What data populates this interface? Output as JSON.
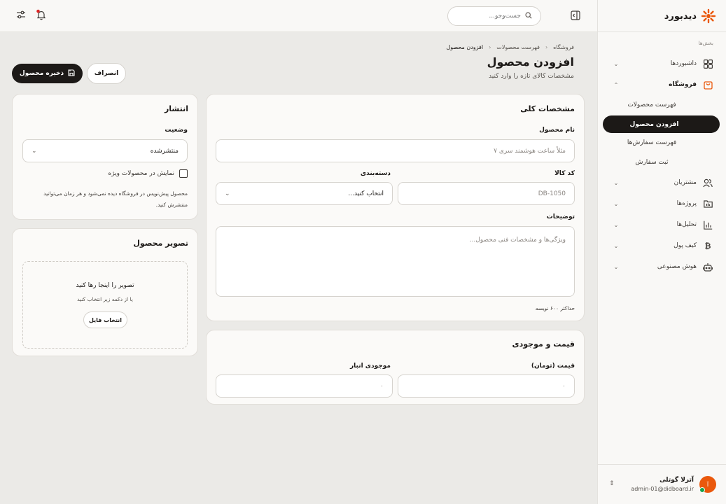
{
  "brand": {
    "name": "دیدبورد",
    "accent": "#ea580c"
  },
  "topbar": {
    "search_placeholder": "جست‌وجو..."
  },
  "sidebar": {
    "section_label": "بخش‌ها",
    "items": [
      {
        "label": "داشبوردها",
        "icon": "grid-icon"
      },
      {
        "label": "فروشگاه",
        "icon": "shopping-bag-icon"
      },
      {
        "label": "مشتریان",
        "icon": "users-icon"
      },
      {
        "label": "پروژه‌ها",
        "icon": "folder-icon"
      },
      {
        "label": "تحلیل‌ها",
        "icon": "bar-chart-icon"
      },
      {
        "label": "کیف پول",
        "icon": "bitcoin-icon"
      },
      {
        "label": "هوش مصنوعی",
        "icon": "robot-icon"
      }
    ],
    "shop_sub": [
      {
        "label": "فهرست محصولات"
      },
      {
        "label": "افزودن محصول",
        "active": true
      },
      {
        "label": "فهرست سفارش‌ها"
      },
      {
        "label": "ثبت سفارش"
      }
    ]
  },
  "user": {
    "name": "آتزلا گوتلی",
    "email": "admin-01@didboard.ir",
    "initial": "آ"
  },
  "breadcrumb": {
    "items": [
      "فروشگاه",
      "فهرست محصولات",
      "افزودن محصول"
    ]
  },
  "page": {
    "title": "افزودن محصول",
    "subtitle": "مشخصات کالای تازه را وارد کنید"
  },
  "actions": {
    "save": "ذخیره محصول",
    "cancel": "انصراف"
  },
  "general": {
    "title": "مشخصات کلی",
    "name_label": "نام محصول",
    "name_placeholder": "مثلاً ساعت هوشمند سری ۷",
    "sku_label": "کد کالا",
    "sku_placeholder": "DB-1050",
    "category_label": "دسته‌بندی",
    "category_value": "انتخاب کنید...",
    "desc_label": "توضیحات",
    "desc_placeholder": "ویژگی‌ها و مشخصات فنی محصول...",
    "desc_hint": "حداکثر ۶۰۰ نویسه"
  },
  "pricing": {
    "title": "قیمت و موجودی",
    "price_label": "قیمت (تومان)",
    "price_value": "۰",
    "stock_label": "موجودی انبار",
    "stock_value": "۰"
  },
  "publish": {
    "title": "انتشار",
    "status_label": "وضعیت",
    "status_value": "منتشرشده",
    "featured_label": "نمایش در محصولات ویژه",
    "note": "محصول پیش‌نویس در فروشگاه دیده نمی‌شود و هر زمان می‌توانید منتشرش کنید."
  },
  "image": {
    "title": "تصویر محصول",
    "drop_title": "تصویر را اینجا رها کنید",
    "drop_sub": "یا از دکمه زیر انتخاب کنید",
    "choose": "انتخاب فایل"
  }
}
